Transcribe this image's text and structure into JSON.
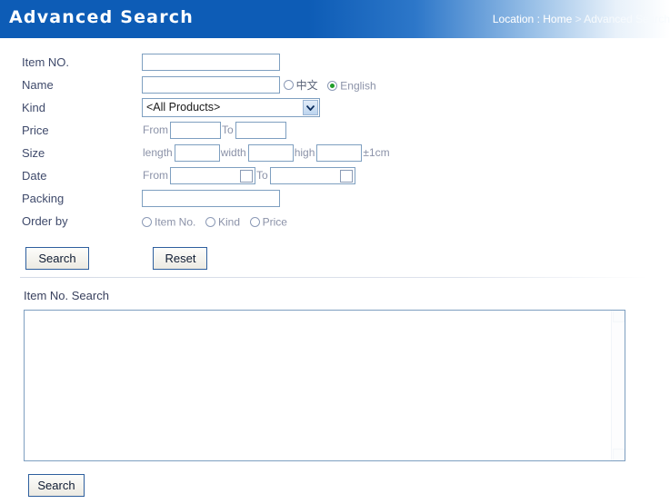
{
  "header": {
    "title": "Advanced Search",
    "location_prefix": "Location : ",
    "location_home": "Home",
    "location_separator": " > ",
    "location_current": "Advanced Search",
    "bar_color": "#0d5cb6",
    "title_color": "#ffffff"
  },
  "form": {
    "rows": {
      "item_no": {
        "label": "Item NO.",
        "input_value": "",
        "input_placeholder": ""
      },
      "name": {
        "label": "Name",
        "input_value": "",
        "input_placeholder": "",
        "lang_options": [
          {
            "label": "中文",
            "checked": false
          },
          {
            "label": "English",
            "checked": true
          }
        ]
      },
      "kind": {
        "label": "Kind",
        "selected_option": "<All Products>",
        "dropdown_icon": "chevron-down-icon"
      },
      "price": {
        "label": "Price",
        "from_label": "From",
        "from_value": "",
        "to_label": "To",
        "to_value": ""
      },
      "size": {
        "label": "Size",
        "length_label": "length",
        "length_value": "",
        "width_label": "width",
        "width_value": "",
        "high_label": "high",
        "high_value": "",
        "tolerance": "±1cm"
      },
      "date": {
        "label": "Date",
        "from_label": "From",
        "from_value": "",
        "to_label": "To",
        "to_value": "",
        "picker_icon": "calendar-icon"
      },
      "packing": {
        "label": "Packing",
        "input_value": "",
        "input_placeholder": ""
      },
      "order_by": {
        "label": "Order by",
        "options": [
          {
            "label": "Item No.",
            "checked": false
          },
          {
            "label": "Kind",
            "checked": false
          },
          {
            "label": "Price",
            "checked": false
          }
        ]
      }
    },
    "buttons": {
      "search": "Search",
      "reset": "Reset"
    }
  },
  "lower": {
    "section_label": "Item No. Search",
    "textarea_value": "",
    "textarea_placeholder": "",
    "search_button": "Search"
  },
  "colors": {
    "accent_blue": "#0d5cb6",
    "input_border": "#7e9fc0",
    "label_text": "#39415e",
    "muted_text": "#8b92a8",
    "radio_checked": "#1f9e29",
    "button_border": "#2e5f9e"
  }
}
